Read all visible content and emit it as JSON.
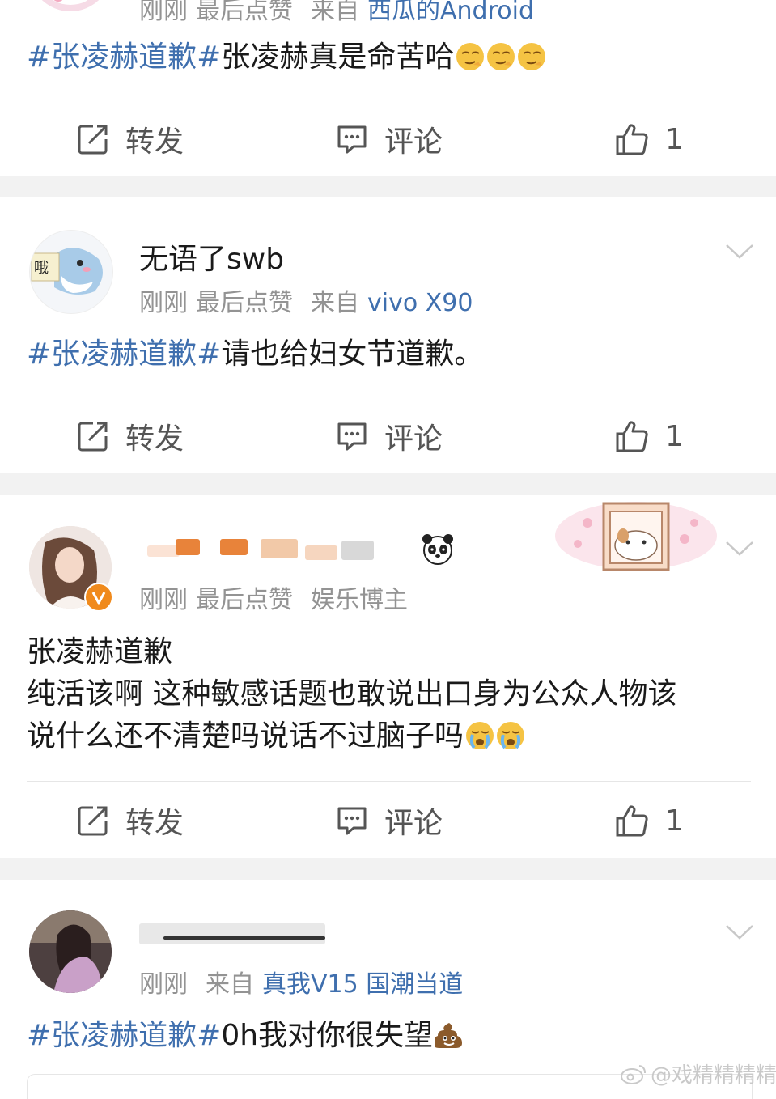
{
  "posts": [
    {
      "name": "",
      "meta": {
        "time": "刚刚",
        "like_note": "最后点赞",
        "from_label": "来自",
        "source": "西瓜的Android"
      },
      "content": {
        "topic": "#张凌赫道歉#",
        "text": "张凌赫真是命苦哈"
      },
      "actions": {
        "repost": "转发",
        "comment": "评论",
        "like_count": "1"
      }
    },
    {
      "name": "无语了swb",
      "meta": {
        "time": "刚刚",
        "like_note": "最后点赞",
        "from_label": "来自",
        "source": "vivo X90"
      },
      "content": {
        "topic": "#张凌赫道歉#",
        "text": "请也给妇女节道歉。"
      },
      "actions": {
        "repost": "转发",
        "comment": "评论",
        "like_count": "1"
      }
    },
    {
      "name": "",
      "meta": {
        "time": "刚刚",
        "like_note": "最后点赞",
        "tag": "娱乐博主"
      },
      "content": {
        "line1": "张凌赫道歉",
        "line2": "纯活该啊 这种敏感话题也敢说出口身为公众人物该",
        "line3": "说什么还不清楚吗说话不过脑子吗"
      },
      "actions": {
        "repost": "转发",
        "comment": "评论",
        "like_count": "1"
      }
    },
    {
      "name": "",
      "meta": {
        "time": "刚刚",
        "from_label": "来自",
        "source": "真我V15 国潮当道"
      },
      "content": {
        "topic": "#张凌赫道歉#",
        "text": "0h我对你很失望"
      }
    }
  ],
  "avatar_1_text": "哦",
  "watermark": "@戏精精精精",
  "colors": {
    "link": "#3f6fae",
    "meta": "#939393",
    "separator": "#f2f2f2",
    "verified": "#f08a1c"
  }
}
